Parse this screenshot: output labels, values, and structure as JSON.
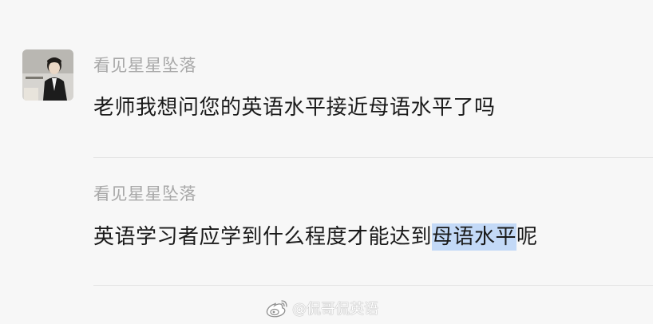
{
  "messages": [
    {
      "nickname": "看见星星坠落",
      "text": "老师我想问您的英语水平接近母语水平了吗"
    },
    {
      "nickname": "看见星星坠落",
      "text_before": "英语学习者应学到什么程度才能达到",
      "text_highlight": "母语水平",
      "text_after": "呢"
    }
  ],
  "watermark": {
    "icon": "weibo-icon",
    "text": "@侃哥侃英语"
  },
  "colors": {
    "background": "#f7f7f7",
    "nickname": "#a8a8a8",
    "message": "#1a1a1a",
    "selection": "#c3d9f7",
    "divider": "#e3e3e3"
  }
}
